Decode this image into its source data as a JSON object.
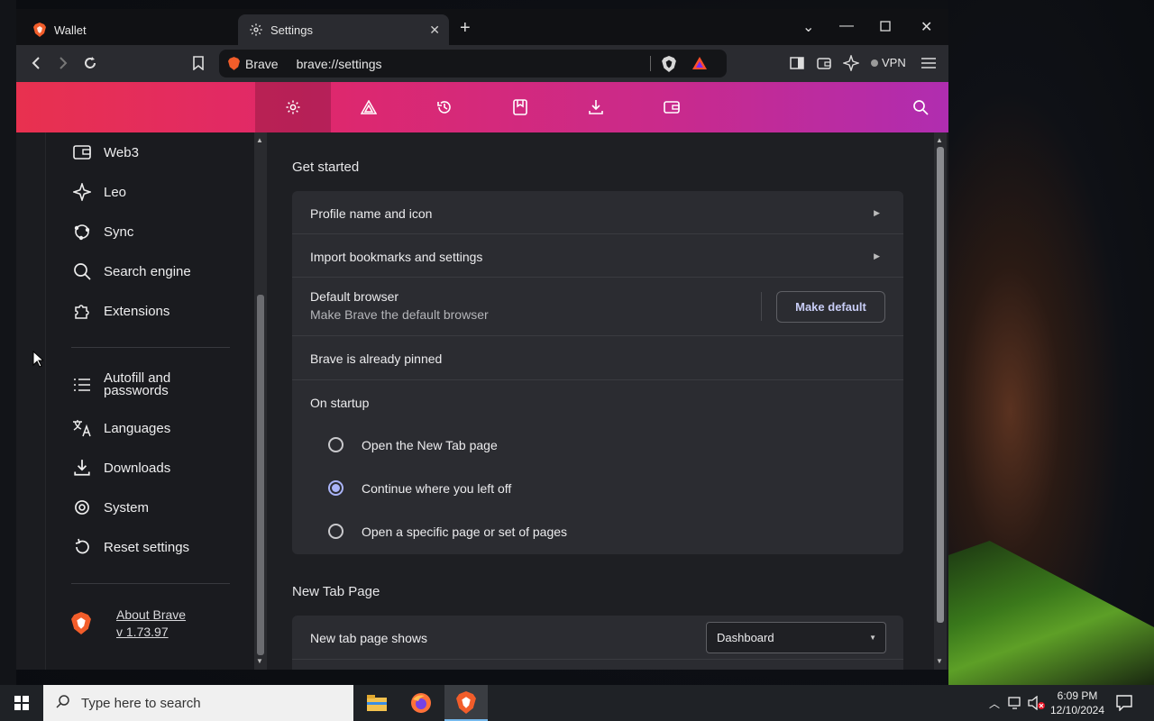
{
  "tabs": [
    {
      "label": "Wallet"
    },
    {
      "label": "Settings"
    }
  ],
  "address": {
    "site_label": "Brave",
    "url": "brave://settings"
  },
  "toolbar": {
    "vpn_label": "VPN"
  },
  "sidebar": {
    "items": [
      {
        "label": "Web3"
      },
      {
        "label": "Leo"
      },
      {
        "label": "Sync"
      },
      {
        "label": "Search engine"
      },
      {
        "label": "Extensions"
      },
      {
        "label": "Autofill and passwords"
      },
      {
        "label": "Languages"
      },
      {
        "label": "Downloads"
      },
      {
        "label": "System"
      },
      {
        "label": "Reset settings"
      }
    ],
    "about": {
      "title": "About Brave",
      "version": "v 1.73.97"
    }
  },
  "get_started": {
    "title": "Get started",
    "profile": "Profile name and icon",
    "import": "Import bookmarks and settings",
    "default_browser": {
      "label": "Default browser",
      "sub": "Make Brave the default browser",
      "button": "Make default"
    },
    "pinned": "Brave is already pinned",
    "on_startup": {
      "label": "On startup",
      "options": [
        {
          "label": "Open the New Tab page",
          "selected": false
        },
        {
          "label": "Continue where you left off",
          "selected": true
        },
        {
          "label": "Open a specific page or set of pages",
          "selected": false
        }
      ]
    }
  },
  "new_tab_page": {
    "title": "New Tab Page",
    "shows_label": "New tab page shows",
    "shows_value": "Dashboard"
  },
  "taskbar": {
    "search_placeholder": "Type here to search",
    "time": "6:09 PM",
    "date": "12/10/2024"
  },
  "colors": {
    "header_gradient_start": "#e8314f",
    "header_gradient_end": "#b02db0",
    "accent_radio": "#aab4f8"
  }
}
